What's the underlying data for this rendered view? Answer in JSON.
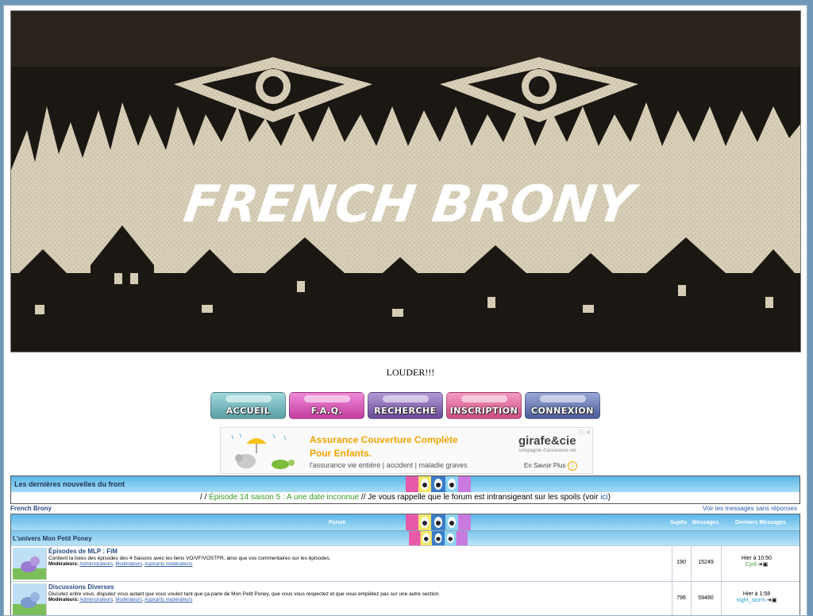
{
  "banner": {
    "title": "FRENCH BRONY",
    "colors": {
      "dark": "#1b1712",
      "light": "#d8cfb8"
    }
  },
  "motto": "LOUDER!!!",
  "nav": [
    {
      "label": "ACCUEIL",
      "color": "#5aa0a6"
    },
    {
      "label": "F.A.Q.",
      "color": "#d04cb0"
    },
    {
      "label": "RECHERCHE",
      "color": "#7a58a8"
    },
    {
      "label": "INSCRIPTION",
      "color": "#d85a8e"
    },
    {
      "label": "CONNEXION",
      "color": "#5a6ea8"
    }
  ],
  "ad": {
    "line1": "Assurance Couverture Complète",
    "line2": "Pour Enfants.",
    "line3": "l'assurance vie entière | accident | maladie graves",
    "brand": "girafe&cie",
    "brand_sub": "compagnie d'assurance vie",
    "cta": "En Savoir Plus",
    "cta_arrow": "›",
    "close": "ⓘ ✕"
  },
  "news": {
    "title": "Les dernières nouvelles du front",
    "prefix": "/ / ",
    "episode": "Épisode 14 saison 5 : A une date inconnue",
    "middle": " // Je vous rappelle que le forum est intransigeant sur les spoils (voir ",
    "link": "ici",
    "suffix": ")"
  },
  "breadcrumb": "French Brony",
  "unanswered_link": "Voir les messages sans réponses",
  "forum_table": {
    "headers": {
      "forum": "Forum",
      "topics": "Sujets",
      "messages": "Messages",
      "last": "Derniers Messages"
    },
    "category": "L'univers Mon Petit Poney",
    "rows": [
      {
        "name": "Épisodes de MLP : FiM",
        "description": "Contient la listes des épisodes des 4 Saisons avec les liens VO/VF/VOSTFR, ainsi que vos commentaires sur les épisodes.",
        "mods_label": "Modérateurs:",
        "mods": [
          "Administrateurs",
          "Modérateurs",
          "Aspirants modérateurs"
        ],
        "topics": "190",
        "messages": "15249",
        "last_time": "Hier à 10:50",
        "last_user": "Cyril",
        "user_color": "green"
      },
      {
        "name": "Discussions Diverses",
        "description": "Discutez entre vous, disputez vous autant que vous voulez tant que ça parle de Mon Petit Poney, que vous vous respectez et que vous empiétez pas sur une autre section.",
        "mods_label": "Modérateurs:",
        "mods": [
          "Administrateurs",
          "Modérateurs",
          "Aspirants modérateurs"
        ],
        "topics": "796",
        "messages": "59480",
        "last_time": "Hier à 1:58",
        "last_user": "night_storm",
        "user_color": "blue"
      }
    ]
  }
}
